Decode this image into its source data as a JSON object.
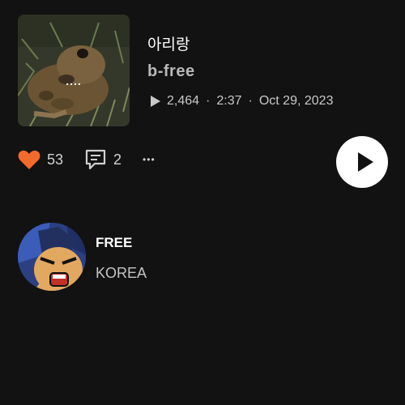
{
  "track": {
    "title": "아리랑",
    "artist": "b-free",
    "plays": "2,464",
    "duration": "2:37",
    "date": "Oct 29, 2023",
    "separator": "·",
    "artwork_menu": "...."
  },
  "actions": {
    "likes": "53",
    "comments": "2",
    "more": "•••"
  },
  "profile": {
    "name": "FREE",
    "subtitle": "KOREA"
  },
  "colors": {
    "background": "#121212",
    "like_accent": "#f26b2b",
    "text_primary": "#ffffff",
    "text_secondary": "#c4c4c4"
  },
  "icons": [
    "heart-icon",
    "comment-icon",
    "more-icon",
    "play-icon"
  ]
}
